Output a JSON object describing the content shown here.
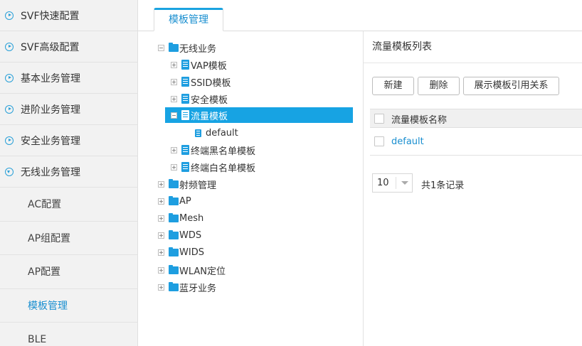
{
  "sidebar": {
    "items": [
      {
        "label": "SVF快速配置",
        "open": false
      },
      {
        "label": "SVF高级配置",
        "open": false
      },
      {
        "label": "基本业务管理",
        "open": false
      },
      {
        "label": "进阶业务管理",
        "open": false
      },
      {
        "label": "安全业务管理",
        "open": false
      },
      {
        "label": "无线业务管理",
        "open": true
      }
    ],
    "sub_items": [
      {
        "label": "AC配置"
      },
      {
        "label": "AP组配置"
      },
      {
        "label": "AP配置"
      },
      {
        "label": "模板管理",
        "active": true
      },
      {
        "label": "BLE"
      }
    ]
  },
  "tabs": {
    "active_label": "模板管理"
  },
  "tree": {
    "root": "无线业务",
    "templates": [
      "VAP模板",
      "SSID模板",
      "安全模板",
      "流量模板",
      "default",
      "终端黑名单模板",
      "终端白名单模板"
    ],
    "others": [
      "射频管理",
      "AP",
      "Mesh",
      "WDS",
      "WIDS",
      "WLAN定位",
      "蓝牙业务"
    ]
  },
  "panel": {
    "title": "流量模板列表",
    "buttons": {
      "new": "新建",
      "delete": "删除",
      "show_refs": "展示模板引用关系"
    },
    "table": {
      "header": "流量模板名称",
      "rows": [
        "default"
      ]
    },
    "pager": {
      "page_size": "10",
      "records": "共1条记录"
    }
  },
  "colors": {
    "accent": "#17a3e3",
    "link": "#1a8fd0",
    "sidebar_bg": "#f2f2f2"
  }
}
